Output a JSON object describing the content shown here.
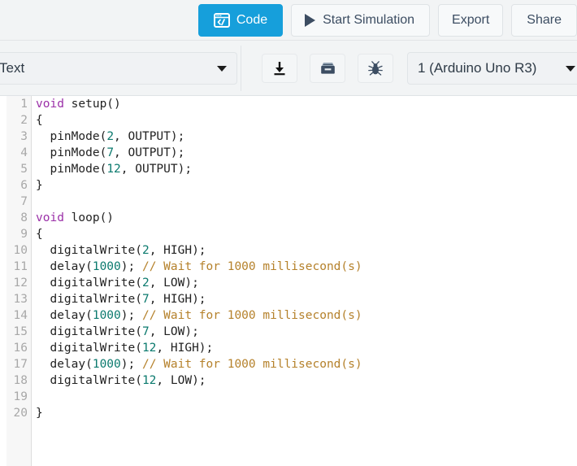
{
  "toolbar": {
    "code_button": {
      "label": "Code",
      "icon": "code-window-icon",
      "accent": "#169fdb"
    },
    "simulation_button": {
      "label": "Start Simulation",
      "icon": "play-icon"
    },
    "export_button": {
      "label": "Export"
    },
    "share_button": {
      "label": "Share"
    }
  },
  "subtoolbar": {
    "editor_mode": {
      "value": "Text",
      "icon": "chevron-down-icon"
    },
    "download_button": {
      "icon": "download-icon"
    },
    "library_button": {
      "icon": "archive-box-icon"
    },
    "debug_button": {
      "icon": "bug-icon"
    },
    "board_select": {
      "value": "1 (Arduino Uno R3)",
      "icon": "chevron-down-icon"
    }
  },
  "editor": {
    "colors": {
      "keyword": "#9b30a8",
      "number": "#0b7a6e",
      "comment": "#b5812b",
      "text": "#222222",
      "line_number": "#a8a8a8",
      "gutter_bg": "#f7f7f7"
    },
    "lines": [
      {
        "n": "1",
        "tokens": [
          {
            "t": "void",
            "c": "kw"
          },
          {
            "t": " setup()",
            "c": ""
          }
        ]
      },
      {
        "n": "2",
        "tokens": [
          {
            "t": "{",
            "c": ""
          }
        ]
      },
      {
        "n": "3",
        "tokens": [
          {
            "t": "  pinMode(",
            "c": ""
          },
          {
            "t": "2",
            "c": "num"
          },
          {
            "t": ", OUTPUT);",
            "c": ""
          }
        ]
      },
      {
        "n": "4",
        "tokens": [
          {
            "t": "  pinMode(",
            "c": ""
          },
          {
            "t": "7",
            "c": "num"
          },
          {
            "t": ", OUTPUT);",
            "c": ""
          }
        ]
      },
      {
        "n": "5",
        "tokens": [
          {
            "t": "  pinMode(",
            "c": ""
          },
          {
            "t": "12",
            "c": "num"
          },
          {
            "t": ", OUTPUT);",
            "c": ""
          }
        ]
      },
      {
        "n": "6",
        "tokens": [
          {
            "t": "}",
            "c": ""
          }
        ]
      },
      {
        "n": "7",
        "tokens": []
      },
      {
        "n": "8",
        "tokens": [
          {
            "t": "void",
            "c": "kw"
          },
          {
            "t": " loop()",
            "c": ""
          }
        ]
      },
      {
        "n": "9",
        "tokens": [
          {
            "t": "{",
            "c": ""
          }
        ]
      },
      {
        "n": "10",
        "tokens": [
          {
            "t": "  digitalWrite(",
            "c": ""
          },
          {
            "t": "2",
            "c": "num"
          },
          {
            "t": ", HIGH);",
            "c": ""
          }
        ]
      },
      {
        "n": "11",
        "tokens": [
          {
            "t": "  delay(",
            "c": ""
          },
          {
            "t": "1000",
            "c": "num"
          },
          {
            "t": "); ",
            "c": ""
          },
          {
            "t": "// Wait for 1000 millisecond(s)",
            "c": "com"
          }
        ]
      },
      {
        "n": "12",
        "tokens": [
          {
            "t": "  digitalWrite(",
            "c": ""
          },
          {
            "t": "2",
            "c": "num"
          },
          {
            "t": ", LOW);",
            "c": ""
          }
        ]
      },
      {
        "n": "13",
        "tokens": [
          {
            "t": "  digitalWrite(",
            "c": ""
          },
          {
            "t": "7",
            "c": "num"
          },
          {
            "t": ", HIGH);",
            "c": ""
          }
        ]
      },
      {
        "n": "14",
        "tokens": [
          {
            "t": "  delay(",
            "c": ""
          },
          {
            "t": "1000",
            "c": "num"
          },
          {
            "t": "); ",
            "c": ""
          },
          {
            "t": "// Wait for 1000 millisecond(s)",
            "c": "com"
          }
        ]
      },
      {
        "n": "15",
        "tokens": [
          {
            "t": "  digitalWrite(",
            "c": ""
          },
          {
            "t": "7",
            "c": "num"
          },
          {
            "t": ", LOW);",
            "c": ""
          }
        ]
      },
      {
        "n": "16",
        "tokens": [
          {
            "t": "  digitalWrite(",
            "c": ""
          },
          {
            "t": "12",
            "c": "num"
          },
          {
            "t": ", HIGH);",
            "c": ""
          }
        ]
      },
      {
        "n": "17",
        "tokens": [
          {
            "t": "  delay(",
            "c": ""
          },
          {
            "t": "1000",
            "c": "num"
          },
          {
            "t": "); ",
            "c": ""
          },
          {
            "t": "// Wait for 1000 millisecond(s)",
            "c": "com"
          }
        ]
      },
      {
        "n": "18",
        "tokens": [
          {
            "t": "  digitalWrite(",
            "c": ""
          },
          {
            "t": "12",
            "c": "num"
          },
          {
            "t": ", LOW);",
            "c": ""
          }
        ]
      },
      {
        "n": "19",
        "tokens": []
      },
      {
        "n": "20",
        "tokens": [
          {
            "t": "}",
            "c": ""
          }
        ]
      }
    ]
  }
}
